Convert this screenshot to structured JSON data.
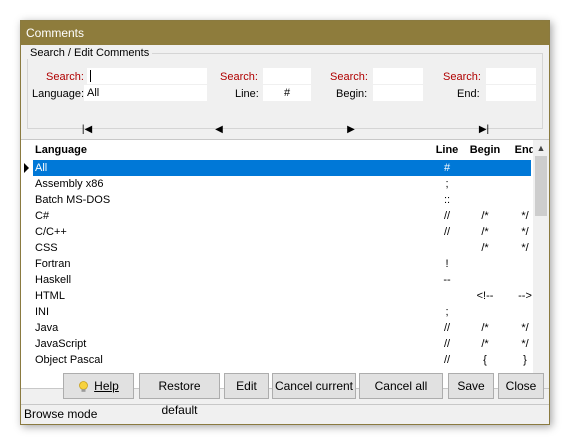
{
  "window": {
    "title": "Comments"
  },
  "search_group": {
    "title": "Search / Edit Comments",
    "search_label": "Search:",
    "language_label": "Language:",
    "language_value": "All",
    "line_label": "Line:",
    "line_value": "#",
    "begin_label": "Begin:",
    "end_label": "End:"
  },
  "nav": {
    "first": "|◀",
    "prev": "◀",
    "next": "▶",
    "last": "▶|"
  },
  "grid": {
    "columns": {
      "language": "Language",
      "line": "Line",
      "begin": "Begin",
      "end": "End"
    },
    "rows": [
      {
        "language": "All",
        "line": "#",
        "begin": "",
        "end": ""
      },
      {
        "language": "Assembly x86",
        "line": ";",
        "begin": "",
        "end": ""
      },
      {
        "language": "Batch MS-DOS",
        "line": "::",
        "begin": "",
        "end": ""
      },
      {
        "language": "C#",
        "line": "//",
        "begin": "/*",
        "end": "*/"
      },
      {
        "language": "C/C++",
        "line": "//",
        "begin": "/*",
        "end": "*/"
      },
      {
        "language": "CSS",
        "line": "",
        "begin": "/*",
        "end": "*/"
      },
      {
        "language": "Fortran",
        "line": "!",
        "begin": "",
        "end": ""
      },
      {
        "language": "Haskell",
        "line": "--",
        "begin": "",
        "end": ""
      },
      {
        "language": "HTML",
        "line": "",
        "begin": "<!--",
        "end": "-->"
      },
      {
        "language": "INI",
        "line": ";",
        "begin": "",
        "end": ""
      },
      {
        "language": "Java",
        "line": "//",
        "begin": "/*",
        "end": "*/"
      },
      {
        "language": "JavaScript",
        "line": "//",
        "begin": "/*",
        "end": "*/"
      },
      {
        "language": "Object Pascal",
        "line": "//",
        "begin": "{",
        "end": "}"
      }
    ]
  },
  "buttons": {
    "help": "Help",
    "restore_default": "Restore default",
    "edit": "Edit",
    "cancel_current": "Cancel current",
    "cancel_all": "Cancel all",
    "save": "Save",
    "close": "Close"
  },
  "status": {
    "text": "Browse mode"
  },
  "colors": {
    "title_bar": "#8e7c3c",
    "selection": "#0078d7",
    "search_label": "#b00000"
  },
  "icons": {
    "help": "lightbulb-icon",
    "scroll_up": "chevron-up-icon",
    "scroll_down": "chevron-down-icon",
    "row_indicator": "row-pointer-icon"
  }
}
